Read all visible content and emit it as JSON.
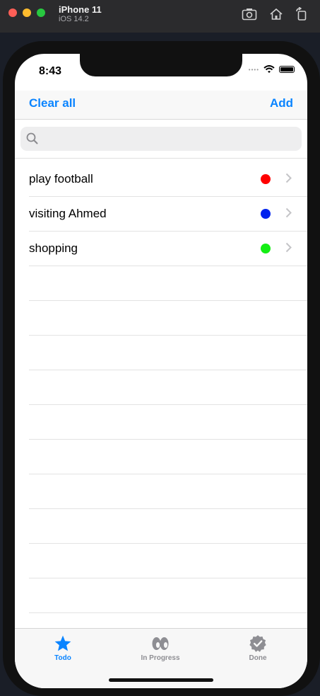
{
  "simulator": {
    "device_name": "iPhone 11",
    "os_version": "iOS 14.2",
    "buttons": [
      "screenshot-icon",
      "home-icon",
      "rotate-icon"
    ]
  },
  "status_bar": {
    "time": "8:43"
  },
  "nav": {
    "left_label": "Clear all",
    "right_label": "Add",
    "accent": "#0a84ff"
  },
  "search": {
    "placeholder": ""
  },
  "tasks": [
    {
      "label": "play football",
      "color": "#ff0000"
    },
    {
      "label": "visiting Ahmed",
      "color": "#0022ee"
    },
    {
      "label": "shopping",
      "color": "#14ee14"
    }
  ],
  "tabs": [
    {
      "label": "Todo",
      "icon": "star-icon",
      "active": true,
      "color": "#0a84ff"
    },
    {
      "label": "In Progress",
      "icon": "eyes-icon",
      "active": false,
      "color": "#8e8e93"
    },
    {
      "label": "Done",
      "icon": "verified-badge-icon",
      "active": false,
      "color": "#8e8e93"
    }
  ]
}
